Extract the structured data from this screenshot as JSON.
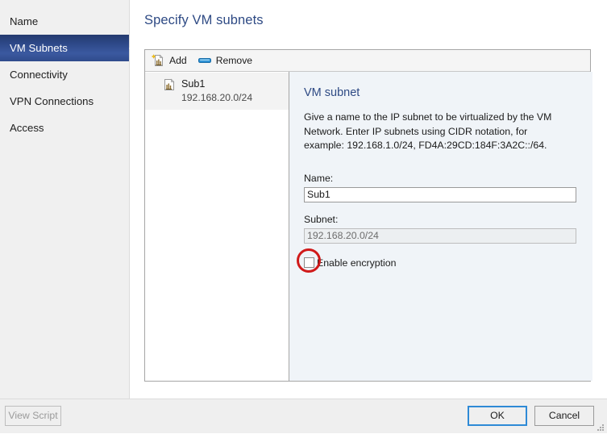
{
  "window": {
    "title": "Specify VM subnets"
  },
  "sidebar": {
    "items": [
      {
        "label": "Name",
        "selected": false
      },
      {
        "label": "VM Subnets",
        "selected": true
      },
      {
        "label": "Connectivity",
        "selected": false
      },
      {
        "label": "VPN Connections",
        "selected": false
      },
      {
        "label": "Access",
        "selected": false
      }
    ]
  },
  "toolbar": {
    "add_label": "Add",
    "add_icon": "add-document-icon",
    "remove_label": "Remove",
    "remove_icon": "remove-bar-icon"
  },
  "list": {
    "items": [
      {
        "icon": "subnet-document-icon",
        "name": "Sub1",
        "subtitle": "192.168.20.0/24"
      }
    ]
  },
  "detail": {
    "title": "VM subnet",
    "description": "Give a name to the IP subnet to be virtualized by the VM Network. Enter IP subnets using CIDR notation, for example: 192.168.1.0/24, FD4A:29CD:184F:3A2C::/64.",
    "name_label": "Name:",
    "name_value": "Sub1",
    "name_placeholder": "",
    "subnet_label": "Subnet:",
    "subnet_value": "192.168.20.0/24",
    "subnet_placeholder": "",
    "encryption_label": "Enable encryption",
    "encryption_checked": false,
    "annotation_color": "#d01a1a"
  },
  "footer": {
    "view_script_label": "View Script",
    "ok_label": "OK",
    "cancel_label": "Cancel"
  },
  "colors": {
    "accent_blue": "#2e4a84",
    "selected_nav": "#2c4786",
    "focus_border": "#2e8ad6",
    "detail_bg": "#f0f4f8"
  }
}
